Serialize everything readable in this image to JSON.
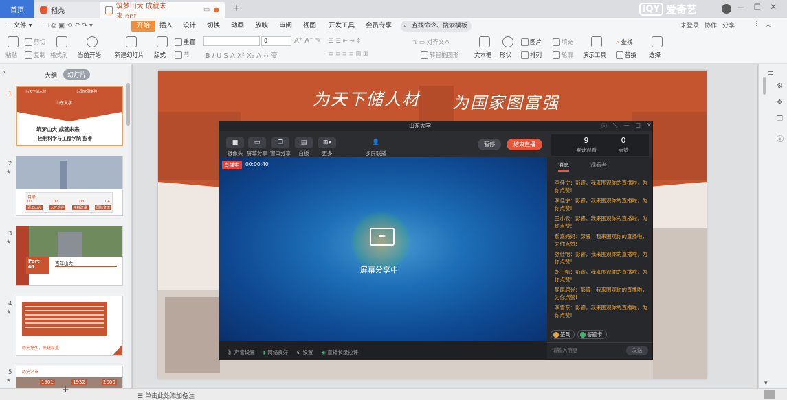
{
  "tabs": {
    "home": "首页",
    "app": "稻壳",
    "doc": "筑梦山大 成就未来.ppt"
  },
  "watermark": "爱奇艺",
  "window_controls": {
    "collab": "协作",
    "share": "分享",
    "user": "未登录"
  },
  "ribbon": {
    "file": "文件",
    "menus": [
      "开始",
      "插入",
      "设计",
      "切换",
      "动画",
      "放映",
      "审阅",
      "视图",
      "开发工具",
      "会员专享"
    ],
    "search_placeholder": "查找命令、搜索模板",
    "paste": "粘贴",
    "cut": "剪切",
    "copy": "复制",
    "format_painter": "格式刷",
    "from_current": "当前开始",
    "new_slide": "新建幻灯片",
    "layout": "版式",
    "reset": "重置",
    "section": "节",
    "font_size": "0",
    "align_text": "对齐文本",
    "convert_smartart": "转智能图形",
    "textbox": "文本框",
    "shape": "形状",
    "picture": "图片",
    "fill": "填充",
    "arrange": "排列",
    "outline": "轮廓",
    "presenter_tools": "演示工具",
    "find": "查找",
    "replace": "替换",
    "select": "选择"
  },
  "left_panel": {
    "tab_outline": "大纲",
    "tab_slides": "幻灯片",
    "slides": [
      {
        "num": "1",
        "title": "筑梦山大 成就未来",
        "subtitle": "控制科学与工程学院 彭睿",
        "header_left": "为天下储人材",
        "header_right": "为国家图富强",
        "badge": "山东大学"
      },
      {
        "num": "2",
        "header": "目录",
        "items": [
          "01",
          "02",
          "03",
          "04"
        ],
        "labels": [
          "百年山大",
          "人才培养",
          "学科建设",
          "国际交流"
        ]
      },
      {
        "num": "3",
        "part": "Part 01",
        "title": "百年山大"
      },
      {
        "num": "4",
        "footer": "历史悠久，底蕴厚重"
      },
      {
        "num": "5",
        "header": "历史沿革",
        "years": [
          "1901",
          "1932",
          "2000"
        ]
      }
    ],
    "add_slide": "+"
  },
  "slide": {
    "calligraphy_left": "为天下储人材",
    "calligraphy_right": "为国家图富强"
  },
  "live": {
    "title": "山东大学",
    "buttons": [
      "摄像头",
      "屏幕分享",
      "窗口分享",
      "白板",
      "更多"
    ],
    "multi_connect": "多屏联播",
    "pause": "暂停",
    "end": "结束直播",
    "viewers_count": "9",
    "viewers_label": "累计观看",
    "likes_count": "0",
    "likes_label": "点赞",
    "tab_messages": "消息",
    "tab_viewers": "观看者",
    "live_badge": "直播中",
    "timer": "00:00:40",
    "sharing": "屏幕分享中",
    "messages": [
      "李佳宁：彭睿，我来围观你的直播啦，为你点赞!",
      "李佳宁：彭睿，我来围观你的直播啦，为你点赞!",
      "王小云：彭睿，我来围观你的直播啦，为你点赞!",
      "郝嘉妈妈：彭睿，我来围观你的直播啦，为你点赞!",
      "张佳怡：彭睿，我来围观你的直播啦，为你点赞!",
      "胡一帆：彭睿，我来围观你的直播啦，为你点赞!",
      "屈屈屈光：彭睿，我来围观你的直播啦，为你点赞!",
      "李雪东：彭睿，我来围观你的直播啦，为你点赞!"
    ],
    "checkin": "签到",
    "answer_card": "答题卡",
    "input_placeholder": "请输入消息",
    "send": "发送",
    "footer": [
      "声音设置",
      "网络良好",
      "设置",
      "直播长录拉评"
    ]
  },
  "notes_placeholder": "单击此处添加备注"
}
